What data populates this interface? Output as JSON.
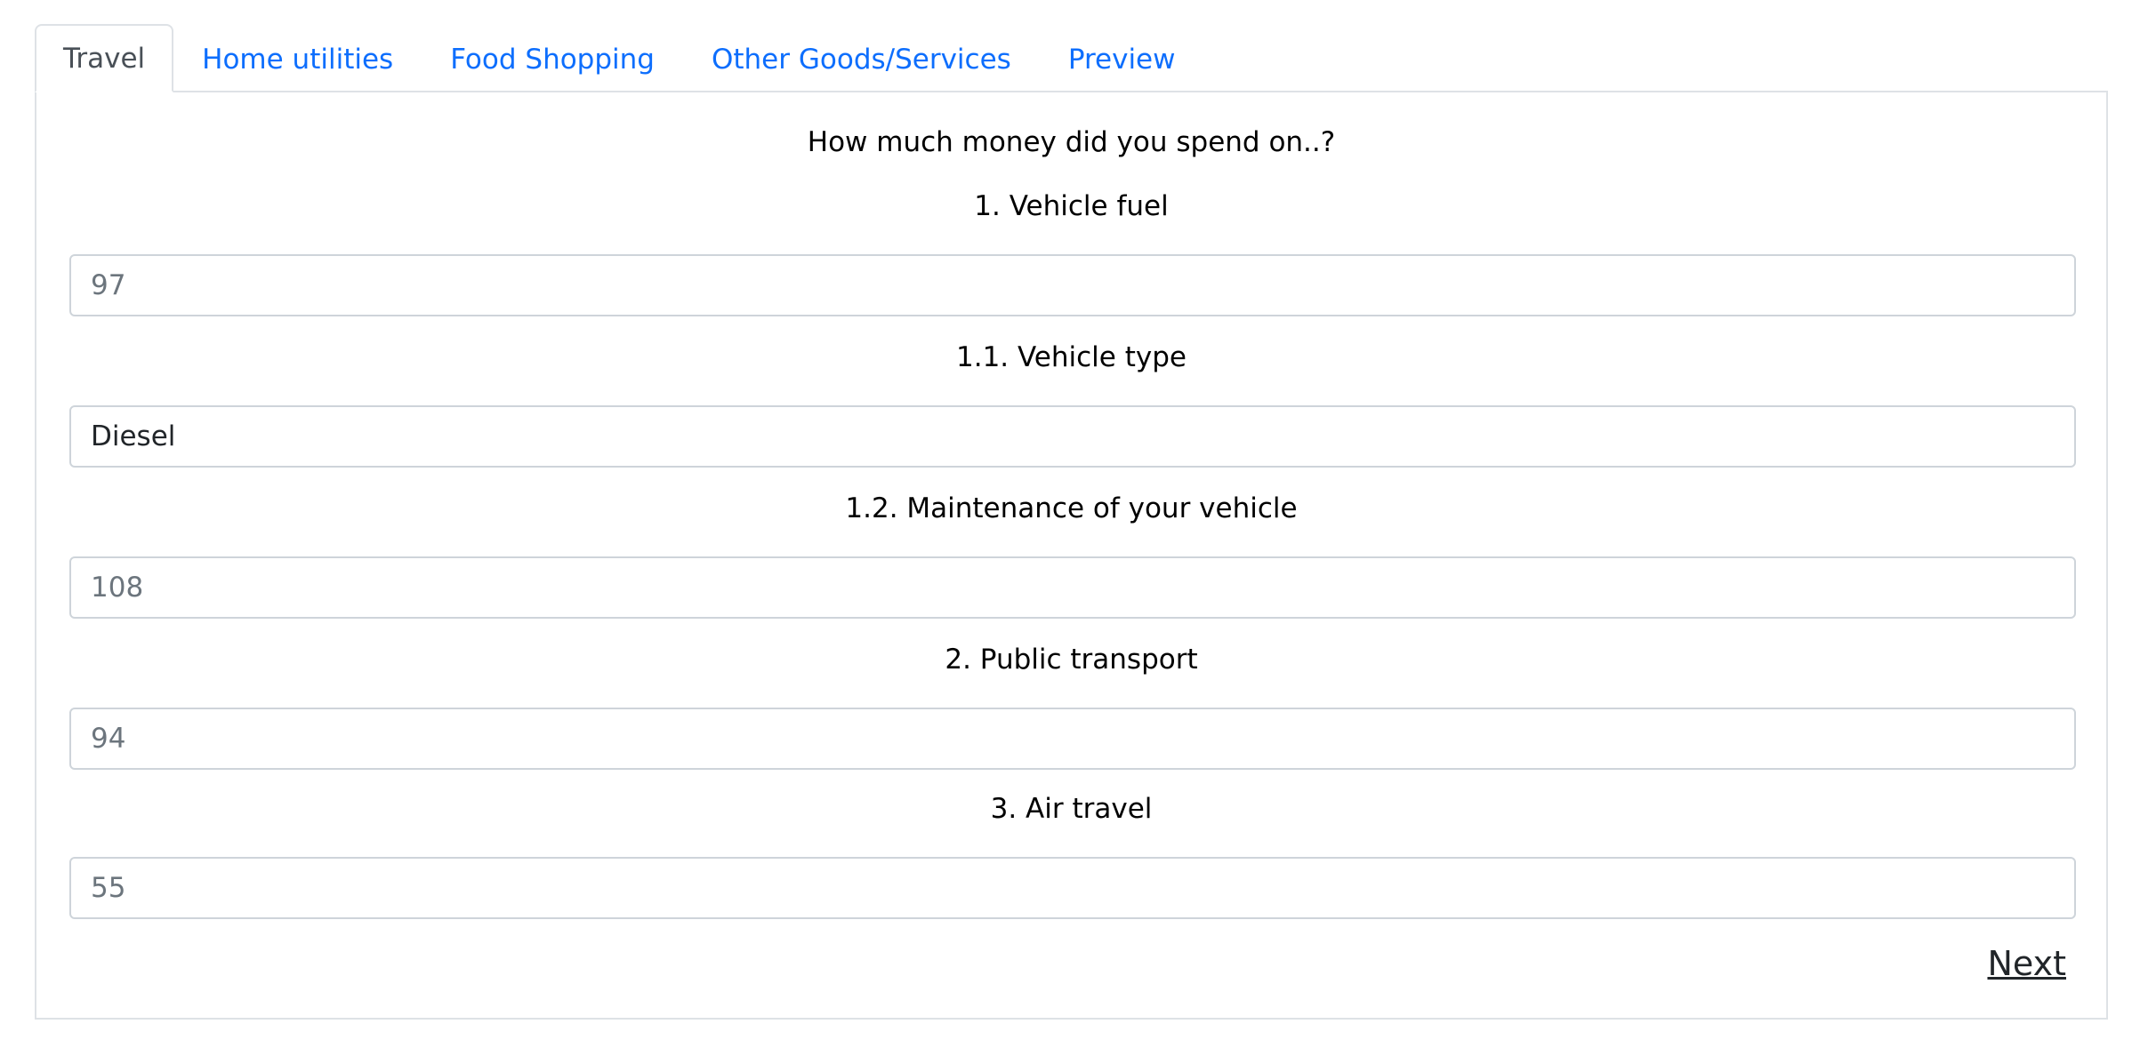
{
  "tabs": [
    {
      "label": "Travel",
      "active": true
    },
    {
      "label": "Home utilities",
      "active": false
    },
    {
      "label": "Food Shopping",
      "active": false
    },
    {
      "label": "Other Goods/Services",
      "active": false
    },
    {
      "label": "Preview",
      "active": false
    }
  ],
  "form": {
    "intro": "How much money did you spend on..?",
    "questions": [
      {
        "label": "1. Vehicle fuel",
        "value": "",
        "placeholder": "97"
      },
      {
        "label": "1.1. Vehicle type",
        "value": "Diesel",
        "placeholder": ""
      },
      {
        "label": "1.2. Maintenance of your vehicle",
        "value": "",
        "placeholder": "108"
      },
      {
        "label": "2. Public transport",
        "value": "",
        "placeholder": "94"
      },
      {
        "label": "3. Air travel",
        "value": "",
        "placeholder": "55"
      }
    ],
    "next_label": "Next"
  }
}
